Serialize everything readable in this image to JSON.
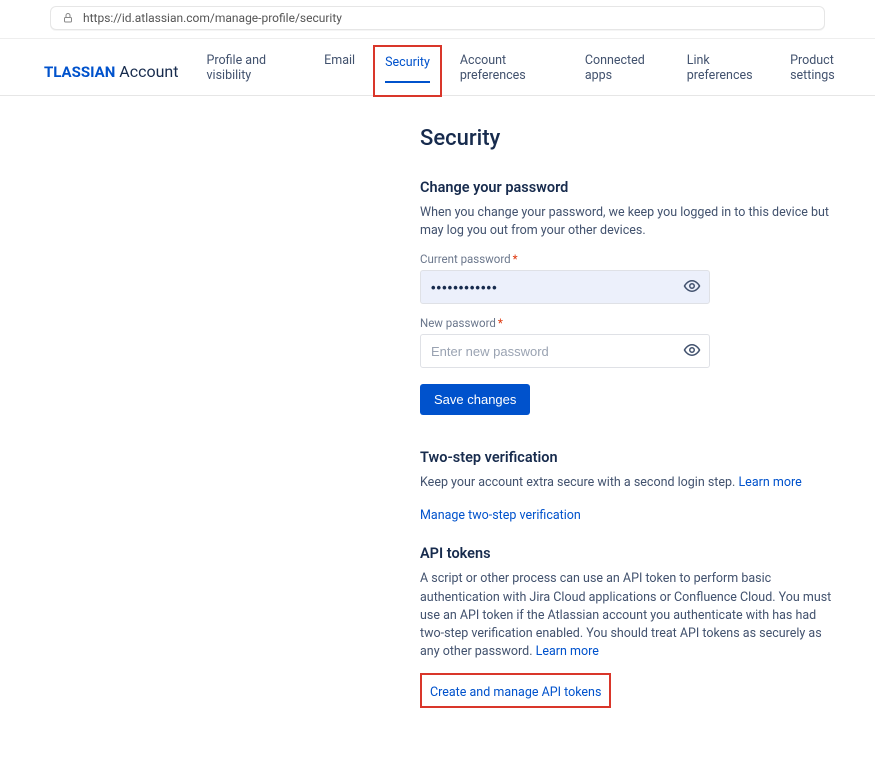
{
  "url": "https://id.atlassian.com/manage-profile/security",
  "brand": {
    "part1": "TLASSIAN",
    "part2": "Account"
  },
  "tabs": {
    "items": [
      {
        "label": "Profile and visibility"
      },
      {
        "label": "Email"
      },
      {
        "label": "Security"
      },
      {
        "label": "Account preferences"
      },
      {
        "label": "Connected apps"
      },
      {
        "label": "Link preferences"
      },
      {
        "label": "Product settings"
      }
    ],
    "activeIndex": 2
  },
  "page": {
    "title": "Security"
  },
  "password": {
    "heading": "Change your password",
    "description": "When you change your password, we keep you logged in to this device but may log you out from your other devices.",
    "currentLabel": "Current password",
    "currentValue": "••••••••••••",
    "newLabel": "New password",
    "newPlaceholder": "Enter new password",
    "saveLabel": "Save changes",
    "required": "*"
  },
  "twostep": {
    "heading": "Two-step verification",
    "description": "Keep your account extra secure with a second login step. ",
    "learnMore": "Learn more",
    "manageLink": "Manage two-step verification"
  },
  "api": {
    "heading": "API tokens",
    "description": "A script or other process can use an API token to perform basic authentication with Jira Cloud applications or Confluence Cloud. You must use an API token if the Atlassian account you authenticate with has had two-step verification enabled. You should treat API tokens as securely as any other password. ",
    "learnMore": "Learn more",
    "manageLink": "Create and manage API tokens"
  }
}
